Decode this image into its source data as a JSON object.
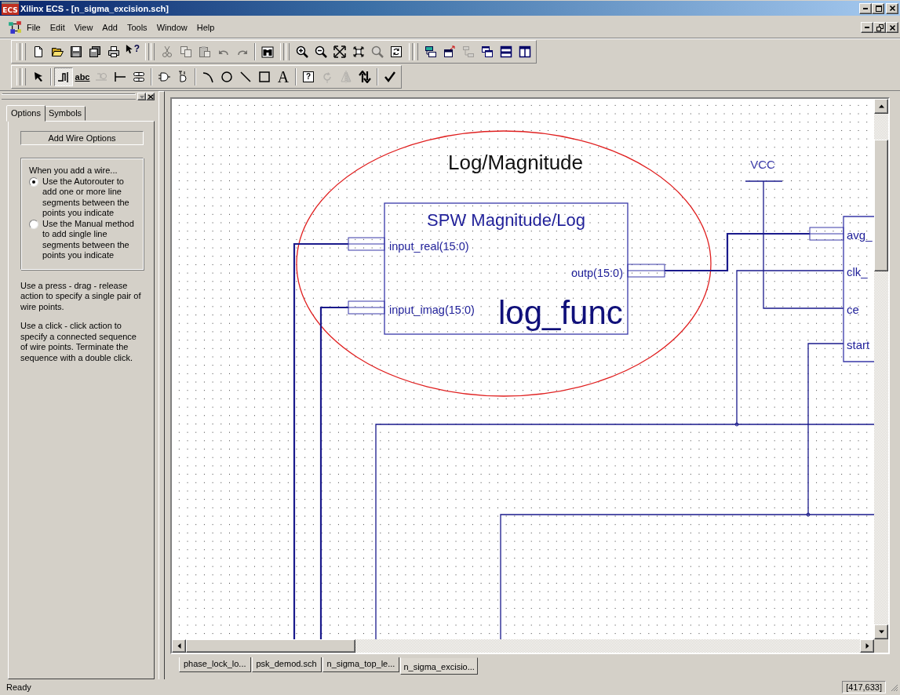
{
  "window": {
    "title": "Xilinx ECS - [n_sigma_excision.sch]",
    "icon_text": "ECS"
  },
  "menu": [
    "File",
    "Edit",
    "View",
    "Add",
    "Tools",
    "Window",
    "Help"
  ],
  "toolbar_main": [
    [
      {
        "kind": "new",
        "disabled": false
      },
      {
        "kind": "open",
        "disabled": false
      },
      {
        "kind": "save",
        "disabled": false
      },
      {
        "kind": "save-all",
        "disabled": false
      },
      {
        "kind": "print",
        "disabled": false
      },
      {
        "kind": "help",
        "glyph": "?",
        "disabled": false
      }
    ],
    [
      {
        "kind": "cut",
        "disabled": true
      },
      {
        "kind": "copy",
        "disabled": true
      },
      {
        "kind": "paste",
        "disabled": true
      },
      {
        "kind": "undo",
        "disabled": true
      },
      {
        "kind": "redo",
        "disabled": true
      }
    ],
    [
      {
        "kind": "find",
        "disabled": false
      }
    ],
    [
      {
        "kind": "zoom-in",
        "disabled": false
      },
      {
        "kind": "zoom-out",
        "disabled": false
      },
      {
        "kind": "zoom-full",
        "disabled": false
      },
      {
        "kind": "zoom-fit",
        "disabled": false
      },
      {
        "kind": "zoom-area",
        "disabled": true
      },
      {
        "kind": "refresh",
        "disabled": false
      }
    ],
    [
      {
        "kind": "push",
        "disabled": false
      },
      {
        "kind": "pop",
        "disabled": false
      },
      {
        "kind": "hierarchy",
        "disabled": true
      },
      {
        "kind": "cascade",
        "disabled": false
      },
      {
        "kind": "tile-h",
        "disabled": false
      },
      {
        "kind": "tile-v",
        "disabled": false
      }
    ]
  ],
  "toolbar_tools": [
    [
      {
        "kind": "select",
        "selected": false,
        "disabled": false
      }
    ],
    [
      {
        "kind": "wire",
        "selected": true,
        "disabled": false
      },
      {
        "kind": "net-name",
        "glyph": "abc",
        "selected": false,
        "disabled": false
      },
      {
        "kind": "bus-tap",
        "selected": false,
        "disabled": true
      },
      {
        "kind": "io-marker",
        "selected": false,
        "disabled": false
      },
      {
        "kind": "attribute",
        "selected": false,
        "disabled": false
      }
    ],
    [
      {
        "kind": "symbol",
        "selected": false,
        "disabled": false
      },
      {
        "kind": "instance",
        "selected": false,
        "disabled": false
      }
    ],
    [
      {
        "kind": "arc",
        "selected": false,
        "disabled": false
      },
      {
        "kind": "circle",
        "selected": false,
        "disabled": false
      },
      {
        "kind": "line",
        "selected": false,
        "disabled": false
      },
      {
        "kind": "rectangle",
        "selected": false,
        "disabled": false
      },
      {
        "kind": "text",
        "glyph": "A",
        "selected": false,
        "disabled": false
      }
    ],
    [
      {
        "kind": "query",
        "glyph": "?",
        "selected": false,
        "disabled": false
      },
      {
        "kind": "rotate",
        "selected": false,
        "disabled": true
      },
      {
        "kind": "mirror",
        "selected": false,
        "disabled": true
      },
      {
        "kind": "swap",
        "selected": false,
        "disabled": false
      }
    ],
    [
      {
        "kind": "check",
        "disabled": false
      }
    ]
  ],
  "options_panel": {
    "tabs": [
      {
        "label": "Options",
        "selected": true
      },
      {
        "label": "Symbols",
        "selected": false
      }
    ],
    "heading": "Add Wire Options",
    "group_title": "When you add a wire...",
    "radios": [
      {
        "label": "Use the Autorouter to add one or more line segments between the points you indicate",
        "selected": true
      },
      {
        "label": "Use the Manual method to add single line segments between the points you indicate",
        "selected": false
      }
    ],
    "notes": [
      "Use a press - drag - release action to specify a single pair of wire points.",
      "Use a click - click action to specify a connected sequence of wire points.  Terminate the sequence with a double click."
    ]
  },
  "schematic": {
    "annotation": "Log/Magnitude",
    "symbol": {
      "title": "SPW Magnitude/Log",
      "instance": "log_func",
      "inputs": [
        "input_real(15:0)",
        "input_imag(15:0)"
      ],
      "output": "outp(15:0)"
    },
    "power_label": "VCC",
    "partial_symbol_pins": [
      "avg_",
      "clk_",
      "ce",
      "start"
    ]
  },
  "document_tabs": [
    {
      "label": "phase_lock_lo...",
      "selected": false
    },
    {
      "label": "psk_demod.sch",
      "selected": false
    },
    {
      "label": "n_sigma_top_le...",
      "selected": false
    },
    {
      "label": "n_sigma_excisio...",
      "selected": true
    }
  ],
  "status_bar": {
    "message": "Ready",
    "coordinates": "[417,633]"
  }
}
